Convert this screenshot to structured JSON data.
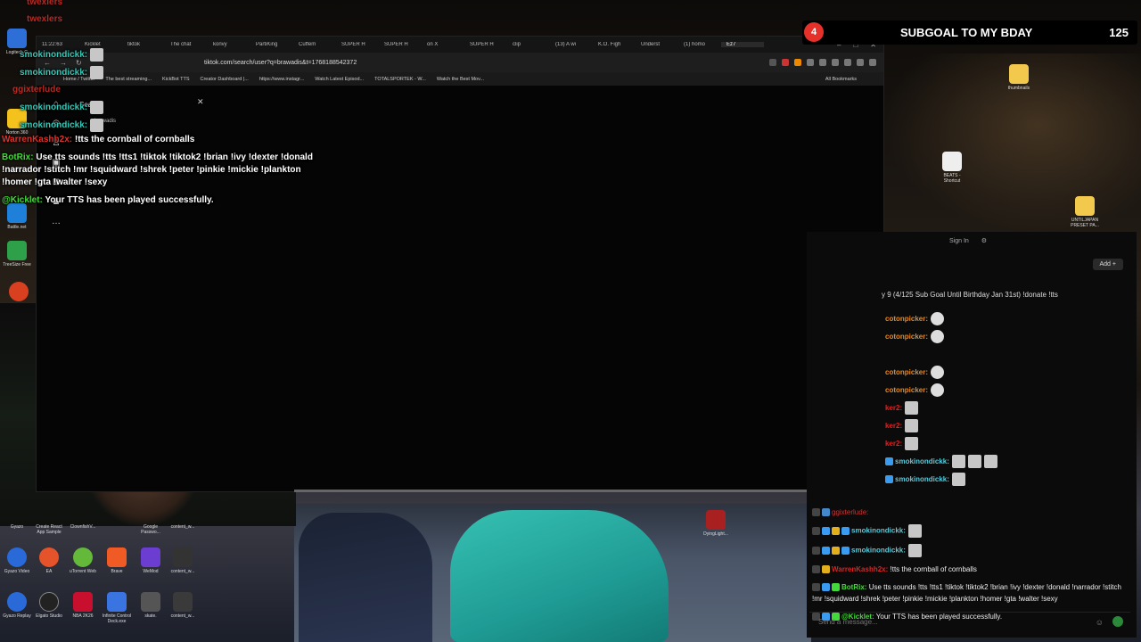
{
  "browser": {
    "tabs": [
      "11:22:63",
      "Kicklet",
      "tiktok",
      "The chat",
      "konvy",
      "PartiKing",
      "Cuffem",
      "SUPER H",
      "SUPER H",
      "on X",
      "SUPER H",
      "clip",
      "(13) A wi",
      "K.O. Figh",
      "Underst",
      "(1) homo",
      "Ez7"
    ],
    "url": "tiktok.com/search/user?q=brawadis&t=1768188542372",
    "bookmarks": [
      "Home / Twitter",
      "The best streaming...",
      "KickBot TTS",
      "Creator Dashboard |...",
      "https://www.instagr...",
      "Watch Latest Episod...",
      "TOTALSPORTEK - W...",
      "Watch the Best Mov..."
    ],
    "all_bookmarks": "All Bookmarks",
    "search_label": "Search",
    "search_query": "brawadis"
  },
  "subgoal": {
    "badge": "4",
    "title": "SUBGOAL TO MY BDAY",
    "count": "125"
  },
  "overlay_chat": {
    "faded_names": [
      "twexlers",
      "twexlers",
      "ggixterlude"
    ],
    "lines": [
      {
        "user": "smokinondickk:",
        "text": ""
      },
      {
        "user": "smokinondickk:",
        "text": ""
      },
      {
        "user": "WarrenKashh2x:",
        "text": "!tts the cornball of cornballs"
      },
      {
        "user": "BotRix:",
        "text": "Use tts sounds !tts !tts1 !tiktok !tiktok2 !brian !ivy !dexter !donald !narrador !stitch !mr !squidward !shrek !peter !pinkie !mickie !plankton !homer !gta !walter !sexy"
      },
      {
        "user": "@Kicklet:",
        "text": "Your TTS has been played successfully."
      }
    ]
  },
  "desktop_icons": {
    "left": [
      "Logitech G",
      "Norton 360",
      "Battle.net",
      "TreeSize Free"
    ],
    "right": [
      "thumbnails",
      "BEATS - Shortcut",
      "UNTILJAPAN PRESET PA..."
    ],
    "bottom_row1": [
      "Gyazo",
      "Create React App Sample",
      "ClownfishV...",
      "",
      "Google Passwo...",
      "content_w..."
    ],
    "bottom_row2": [
      "Gyazo Video",
      "EA",
      "uTorrent Web",
      "Brave",
      "WeMod",
      "content_w..."
    ],
    "bottom_row3": [
      "Gyazo Replay",
      "Elgato Studio",
      "NBA 2K26",
      "Infinite Control Deck.exe",
      "skate.",
      "content_w..."
    ],
    "dying_light": "DyingLight..."
  },
  "chat_panel": {
    "sign_in": "Sign In",
    "add": "Add +",
    "title": "y 9 (4/125 Sub Goal Until Birthday Jan 31st) !donate !tts",
    "names": [
      "cotonpicker:",
      "cotonpicker:",
      "cotonpicker:",
      "cotonpicker:",
      "ker2:",
      "ker2:",
      "ker2:",
      "smokinondickk:",
      "smokinondickk:"
    ],
    "messages": [
      {
        "user": "ggixterlude:",
        "text": ""
      },
      {
        "user": "smokinondickk:",
        "text": ""
      },
      {
        "user": "smokinondickk:",
        "text": ""
      },
      {
        "user": "WarrenKashh2x:",
        "text": "!tts the cornball of cornballs"
      },
      {
        "user": "BotRix:",
        "text": "Use tts sounds !tts !tts1 !tiktok !tiktok2 !brian !ivy !dexter !donald !narrador !stitch !mr !squidward !shrek !peter !pinkie !mickie !plankton !homer !gta !walter !sexy"
      },
      {
        "user": "@Kicklet:",
        "text": "Your TTS has been played successfully."
      }
    ],
    "send_placeholder": "Send a message..."
  }
}
